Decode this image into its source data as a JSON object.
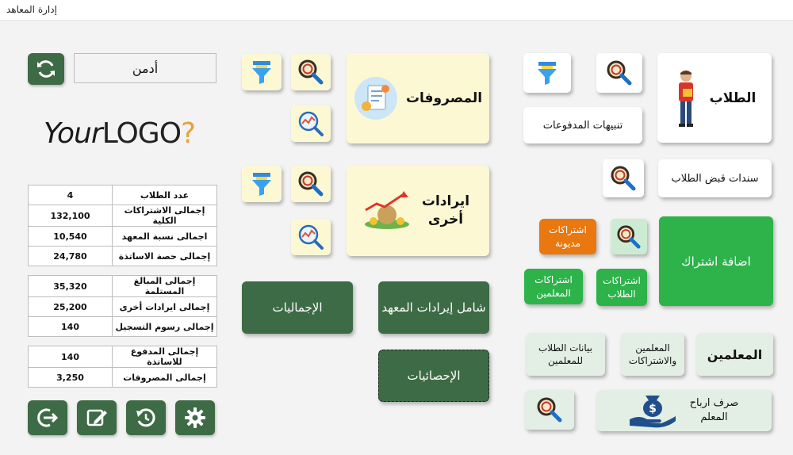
{
  "window": {
    "title": "إدارة المعاهد"
  },
  "user": {
    "name": "أدمن"
  },
  "logo": {
    "part1": "Your",
    "part2": "LOGO",
    "part3": "?"
  },
  "stats": {
    "group1": [
      {
        "label": "عدد الطلاب",
        "value": "4"
      },
      {
        "label": "إجمالى الاشتراكات الكلية",
        "value": "132,100"
      },
      {
        "label": "اجمالى نسبة المعهد",
        "value": "10,540"
      },
      {
        "label": "إجمالى حصة الاساتذة",
        "value": "24,780"
      }
    ],
    "group2": [
      {
        "label": "إجمالى المبالغ المستلمة",
        "value": "35,320"
      },
      {
        "label": "إجمالى ايرادات أخرى",
        "value": "25,200"
      },
      {
        "label": "إجمالى رسوم التسجيل",
        "value": "140"
      }
    ],
    "group3": [
      {
        "label": "إجمالى المدفوع للاساتذة",
        "value": "140"
      },
      {
        "label": "إجمالى المصروفات",
        "value": "3,250"
      }
    ]
  },
  "buttons": {
    "expenses": "المصروفات",
    "other_revenue": "ايرادات أخرى",
    "totals": "الإجماليات",
    "institute_revenue": "شامل إيرادات المعهد",
    "statistics": "الإحصائيات",
    "students": "الطلاب",
    "payment_alerts": "تنبيهات المدفوعات",
    "student_receipts": "سندات قبض الطلاب",
    "debt_subscriptions": "اشتراكات مديونة",
    "add_subscription": "اضافة اشتراك",
    "teacher_subscriptions": "اشتراكات المعلمين",
    "student_subscriptions": "اشتراكات الطلاب",
    "teachers": "المعلمين",
    "teachers_and_subscriptions": "المعلمين والاشتراكات",
    "student_data_for_teachers": "بيانات الطلاب للمعلمين",
    "teacher_profit_payout": "صرف ارباح المعلم"
  },
  "colors": {
    "dark_green": "#3d6b45",
    "green": "#2db34a",
    "orange": "#e8780f",
    "cream": "#fdf8d4",
    "mint": "#e3efe5"
  },
  "icons": {
    "refresh": "refresh-icon",
    "search": "search-icon",
    "filter": "filter-icon",
    "chart": "chart-search-icon",
    "logout": "logout-icon",
    "edit": "edit-icon",
    "restore": "restore-icon",
    "settings": "gear-icon"
  }
}
